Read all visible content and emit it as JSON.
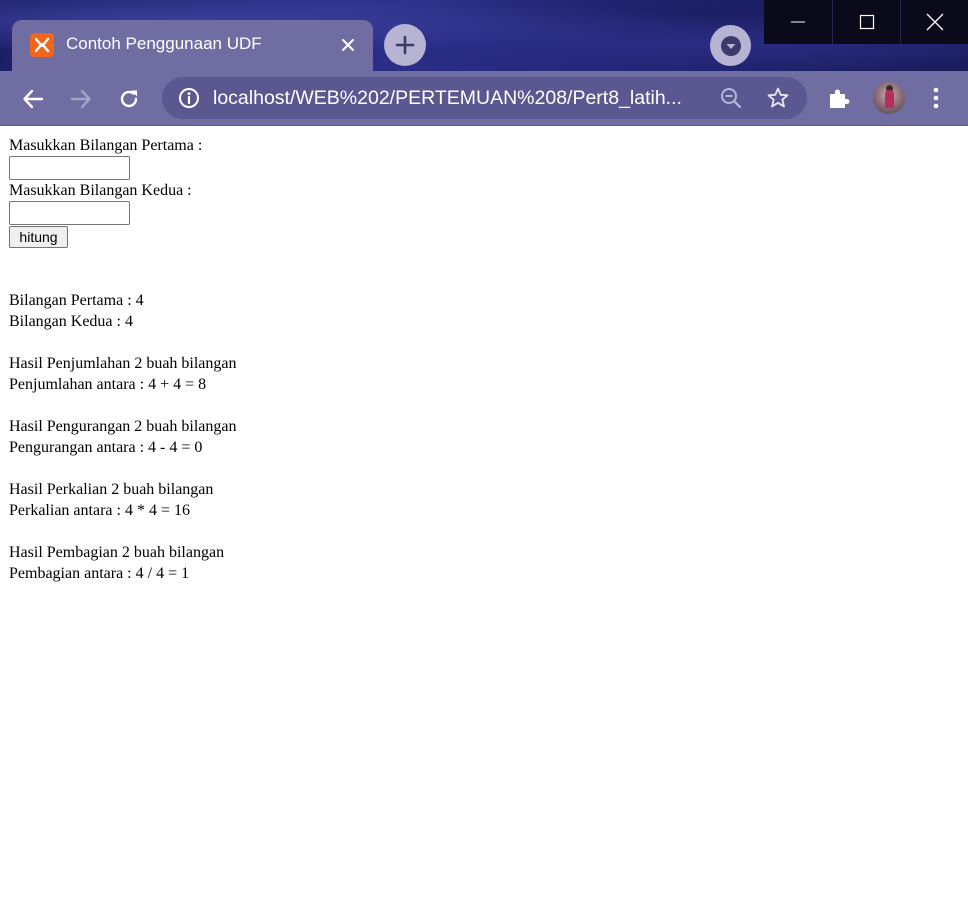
{
  "browser": {
    "tab_title": "Contoh Penggunaan UDF",
    "url": "localhost/WEB%202/PERTEMUAN%208/Pert8_latih..."
  },
  "form": {
    "label_first": "Masukkan Bilangan Pertama :",
    "value_first": "",
    "label_second": "Masukkan Bilangan Kedua :",
    "value_second": "",
    "button_label": "hitung"
  },
  "results": {
    "first_number": "Bilangan Pertama : 4",
    "second_number": "Bilangan Kedua : 4",
    "sum_title": "Hasil Penjumlahan 2 buah bilangan",
    "sum_line": "Penjumlahan antara : 4 + 4 = 8",
    "sub_title": "Hasil Pengurangan 2 buah bilangan",
    "sub_line": "Pengurangan antara : 4 - 4 = 0",
    "mul_title": "Hasil Perkalian 2 buah bilangan",
    "mul_line": "Perkalian antara : 4 * 4 = 16",
    "div_title": "Hasil Pembagian 2 buah bilangan",
    "div_line": "Pembagian antara : 4 / 4 = 1"
  },
  "colors": {
    "chrome_frame": "#6f6da2",
    "omnibox": "#5a5890",
    "favicon": "#f2651d"
  }
}
